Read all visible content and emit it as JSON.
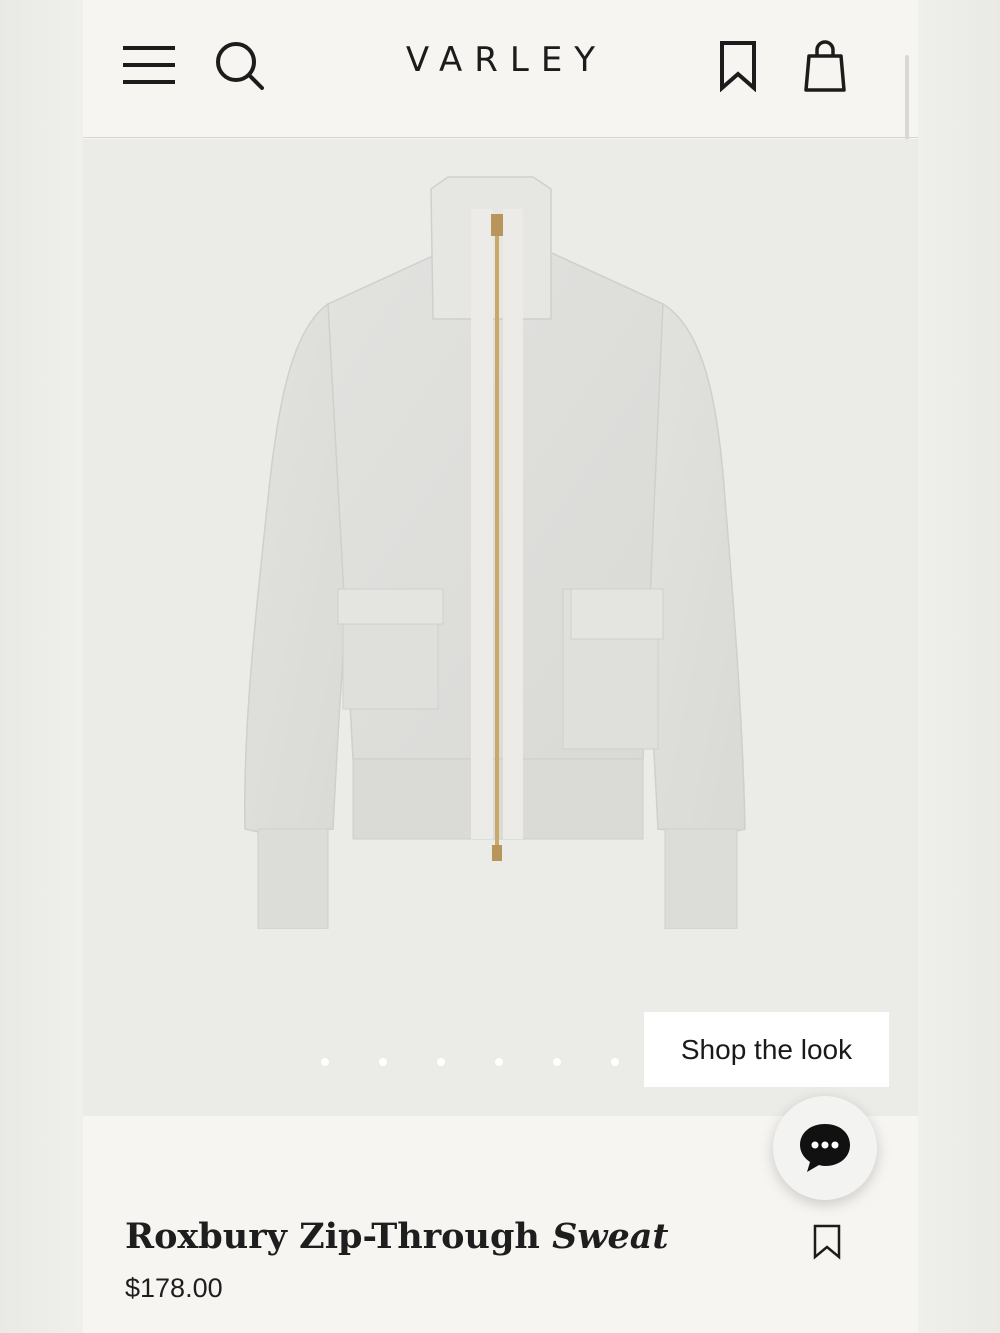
{
  "header": {
    "brand": "VARLEY",
    "icons": {
      "menu": "hamburger-menu-icon",
      "search": "search-icon",
      "bookmark": "bookmark-icon",
      "bag": "shopping-bag-icon"
    }
  },
  "gallery": {
    "image_subject": "light heather grey zip-through high-neck sweat jacket",
    "dots": [
      "",
      "",
      "",
      "",
      "",
      ""
    ],
    "shop_the_look": "Shop the look"
  },
  "chat": {
    "icon": "chat-bubble-icon"
  },
  "product": {
    "title_main": "Roxbury Zip-Through ",
    "title_accent": "Sweat",
    "price": "$178.00",
    "wishlist_icon": "bookmark-icon"
  },
  "colors": {
    "background": "#f6f5f1",
    "image_background": "#ebebe7",
    "text": "#1e1e1e",
    "zipper": "#c9a86a"
  }
}
